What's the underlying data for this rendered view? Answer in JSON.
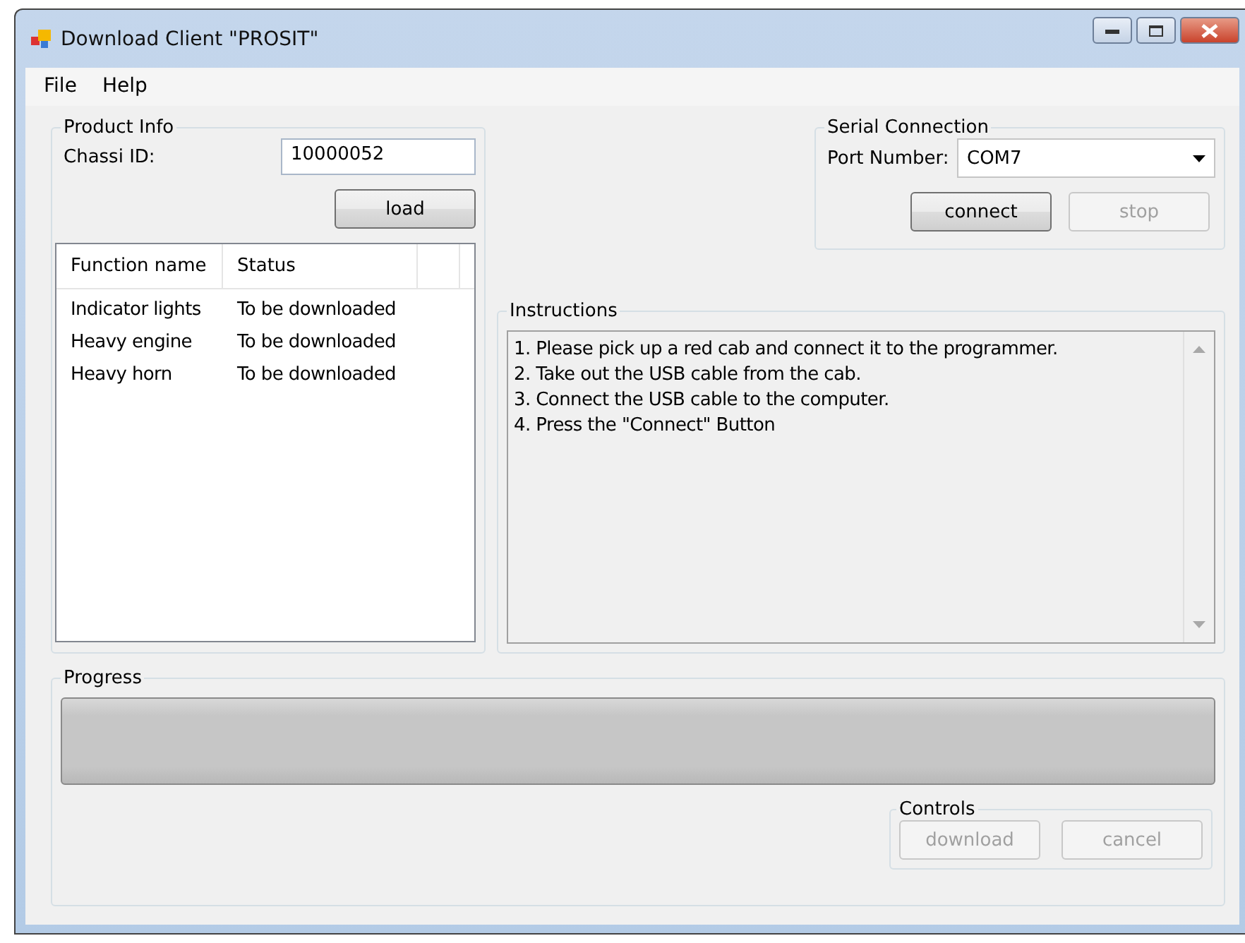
{
  "window": {
    "title": "Download Client \"PROSIT\""
  },
  "menu": [
    "File",
    "Help"
  ],
  "product_info": {
    "title": "Product Info",
    "chassi_label": "Chassi ID:",
    "chassi_value": "10000052",
    "load_button": {
      "label": "load",
      "disabled": false
    },
    "table": {
      "columns": [
        "Function name",
        "Status"
      ],
      "rows": [
        {
          "function": "Indicator lights",
          "status": "To be downloaded"
        },
        {
          "function": "Heavy engine",
          "status": "To be downloaded"
        },
        {
          "function": "Heavy horn",
          "status": "To be downloaded"
        }
      ]
    }
  },
  "serial": {
    "title": "Serial Connection",
    "port_label": "Port Number:",
    "port_value": "COM7",
    "buttons": [
      {
        "label": "connect",
        "disabled": false
      },
      {
        "label": "stop",
        "disabled": true
      }
    ]
  },
  "instructions": {
    "title": "Instructions",
    "lines": [
      "1. Please pick up a red cab and connect it to the programmer.",
      "2. Take out the USB cable from the cab.",
      "3. Connect the USB cable to the computer.",
      "4. Press the \"Connect\" Button"
    ]
  },
  "progress": {
    "title": "Progress"
  },
  "controls": {
    "title": "Controls",
    "buttons": [
      {
        "label": "download",
        "disabled": true
      },
      {
        "label": "cancel",
        "disabled": true
      }
    ]
  }
}
